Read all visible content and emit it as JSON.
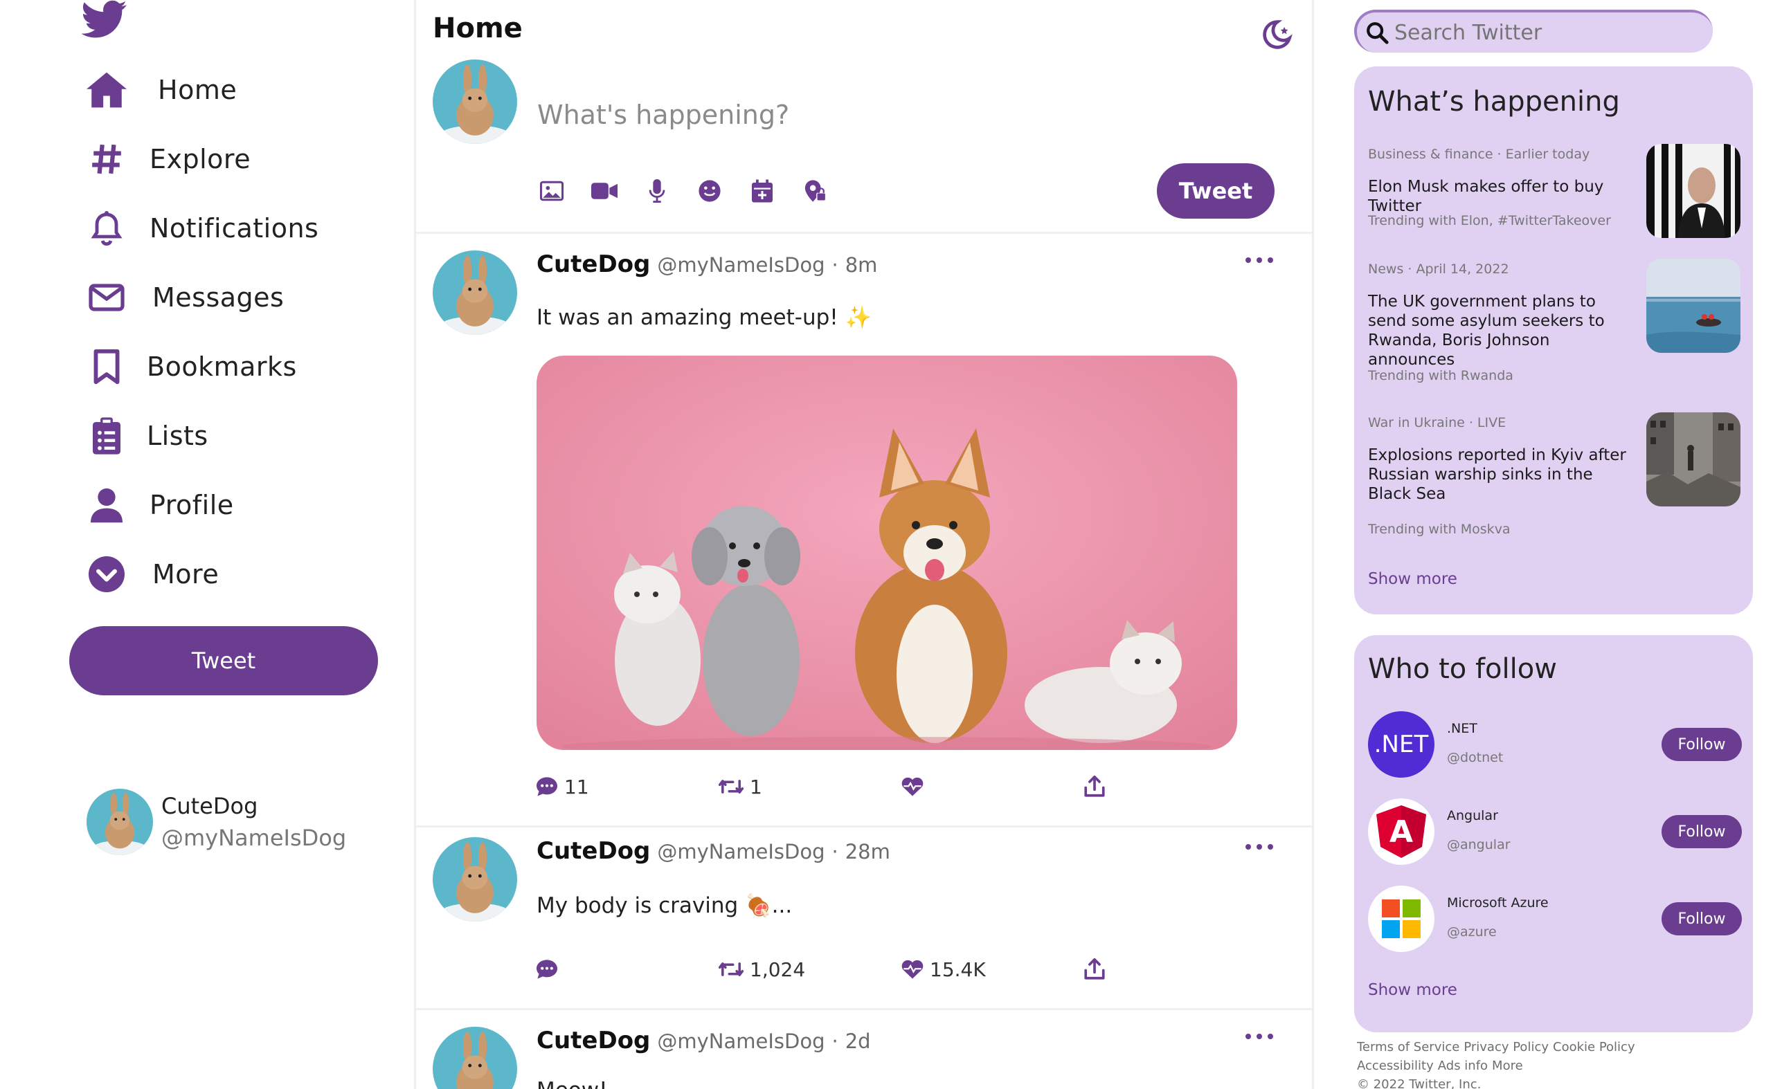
{
  "colors": {
    "accent": "#6a3d91",
    "panel": "#e0d1f3"
  },
  "sidebar": {
    "logo": "twitter-bird-icon",
    "nav": [
      {
        "label": "Home",
        "icon": "home-icon"
      },
      {
        "label": "Explore",
        "icon": "hashtag-icon"
      },
      {
        "label": "Notifications",
        "icon": "bell-icon"
      },
      {
        "label": "Messages",
        "icon": "envelope-icon"
      },
      {
        "label": "Bookmarks",
        "icon": "bookmark-icon"
      },
      {
        "label": "Lists",
        "icon": "clipboard-list-icon"
      },
      {
        "label": "Profile",
        "icon": "user-icon"
      },
      {
        "label": "More",
        "icon": "chevron-circle-icon"
      }
    ],
    "tweet_button": "Tweet",
    "account": {
      "name": "CuteDog",
      "handle": "@myNameIsDog"
    }
  },
  "feed": {
    "title": "Home",
    "composer": {
      "placeholder": "What's happening?",
      "tools": [
        "image-icon",
        "video-icon",
        "microphone-icon",
        "emoji-icon",
        "calendar-icon",
        "location-icon"
      ],
      "tweet_button": "Tweet"
    },
    "tweets": [
      {
        "name": "CuteDog",
        "handle": "@myNameIsDog",
        "dot": "·",
        "time": "8m",
        "text": "It was an amazing meet-up! ✨",
        "comments": "11",
        "retweets": "1",
        "likes": "",
        "has_media": true
      },
      {
        "name": "CuteDog",
        "handle": "@myNameIsDog",
        "dot": "·",
        "time": "28m",
        "text": "My body is craving 🍖...",
        "comments": "",
        "retweets": "1,024",
        "likes": "15.4K",
        "has_media": false
      },
      {
        "name": "CuteDog",
        "handle": "@myNameIsDog",
        "dot": "·",
        "time": "2d",
        "text": "Meow!"
      }
    ]
  },
  "right": {
    "search_placeholder": "Search Twitter",
    "happening": {
      "title": "What’s happening",
      "trends": [
        {
          "meta": "Business & finance · Earlier today",
          "headline": "Elon Musk makes offer to buy Twitter",
          "with": "Trending with Elon, #TwitterTakeover"
        },
        {
          "meta": "News · April 14, 2022",
          "headline": "The UK government plans to send some asylum seekers to Rwanda, Boris Johnson announces",
          "with": "Trending with Rwanda"
        },
        {
          "meta": "War in Ukraine · LIVE",
          "headline": "Explosions reported in Kyiv after Russian warship sinks in the Black Sea",
          "with": "Trending with Moskva"
        }
      ],
      "show_more": "Show more"
    },
    "follow": {
      "title": "Who to follow",
      "accounts": [
        {
          "name": ".NET",
          "handle": "@dotnet",
          "button": "Follow",
          "logo_text": ".NET"
        },
        {
          "name": "Angular",
          "handle": "@angular",
          "button": "Follow",
          "logo_text": "A"
        },
        {
          "name": "Microsoft Azure",
          "handle": "@azure",
          "button": "Follow"
        }
      ],
      "show_more": "Show more"
    },
    "footer": {
      "links": [
        "Terms of Service",
        "Privacy Policy",
        "Cookie Policy",
        "Accessibility",
        "Ads info",
        "More"
      ],
      "copyright": "© 2022 Twitter, Inc."
    }
  }
}
